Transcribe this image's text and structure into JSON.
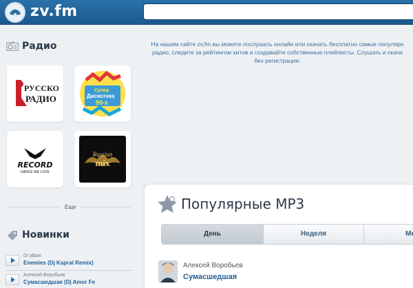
{
  "header": {
    "logo_text": "zv.fm",
    "search_value": ""
  },
  "sidebar": {
    "radio_title": "Радио",
    "stations": [
      {
        "name": "Русское Радио",
        "logo_text_1": "РУССКОЕ",
        "logo_text_2": "РАДИО"
      },
      {
        "name": "Супер Дискотека 90-х",
        "logo_text_1": "Супер",
        "logo_text_2": "Дискотека",
        "logo_text_3": "90-х"
      },
      {
        "name": "Record",
        "logo_text_1": "RECORD",
        "logo_text_2": "DANCE WE LOVE"
      },
      {
        "name": "Russian Mix",
        "logo_text_1": "Russian",
        "logo_text_2": "mix"
      }
    ],
    "more_label": "Еще",
    "new_title": "Новинки",
    "new_items": [
      {
        "artist": "Dr.alban",
        "track": "Enemies (Dj Kapral Remix)"
      },
      {
        "artist": "Алексей Воробьев",
        "track": "Сумасшедшая (Dj Amor Fe"
      }
    ]
  },
  "intro": {
    "line1": "На нашем сайте zv.fm вы можете послушать онлайн или скачать бесплатно самые популярн",
    "line2": "радио, следите за рейтингом хитов и создавайте собственные плейлисты. Слушать и скачи",
    "line3": "без регистрации."
  },
  "popular": {
    "title": "Популярные MP3",
    "tabs": [
      "День",
      "Неделя",
      "Ме"
    ],
    "active_tab": 0,
    "songs": [
      {
        "artist": "Алексей Воробьев",
        "title": "Сумасшедшая"
      }
    ]
  },
  "colors": {
    "header_bg": "#1f629a",
    "accent_link": "#1f5f96",
    "page_bg": "#eef1f4"
  }
}
